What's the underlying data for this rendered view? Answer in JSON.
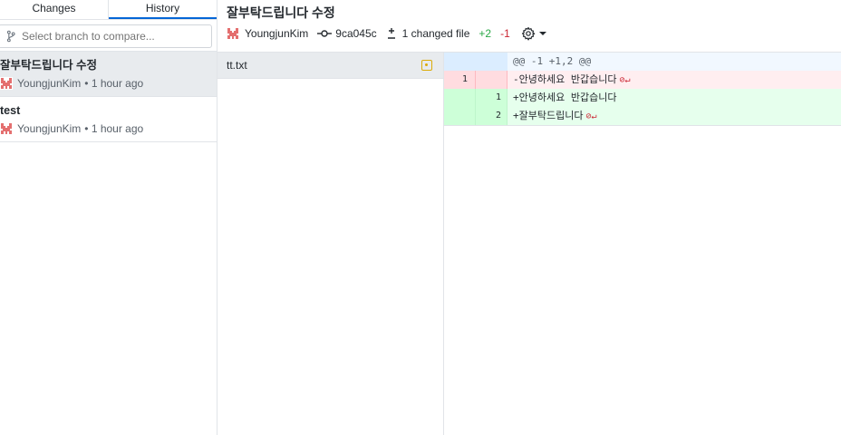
{
  "tabs": {
    "changes_label": "Changes",
    "history_label": "History"
  },
  "compare": {
    "placeholder": "Select branch to compare..."
  },
  "commits": [
    {
      "summary": "잘부탁드립니다 수정",
      "author": "YoungjunKim",
      "time": "• 1 hour ago",
      "selected": true
    },
    {
      "summary": "test",
      "author": "YoungjunKim",
      "time": "• 1 hour ago",
      "selected": false
    }
  ],
  "header": {
    "title": "잘부탁드립니다 수정",
    "author": "YoungjunKim",
    "sha": "9ca045c",
    "changed_files": "1 changed file",
    "additions": "+2",
    "deletions": "-1"
  },
  "files": [
    {
      "name": "tt.txt",
      "status": "modified"
    }
  ],
  "diff": {
    "hunk": "@@ -1 +1,2 @@",
    "lines": [
      {
        "type": "del",
        "old": "1",
        "new": "",
        "text": "-안녕하세요 반갑습니다"
      },
      {
        "type": "ins",
        "old": "",
        "new": "1",
        "text": "+안녕하세요 반갑습니다"
      },
      {
        "type": "ins",
        "old": "",
        "new": "2",
        "text": "+잘부탁드립니다"
      }
    ],
    "no_newline_marker": "⊘↵"
  },
  "icons": {
    "branch": "branch-icon",
    "avatar": "avatar-icon",
    "commit": "commit-icon",
    "diff": "diff-icon",
    "gear": "gear-icon",
    "modified": "file-modified-icon"
  },
  "colors": {
    "accent": "#0366d6",
    "added": "#28a745",
    "removed": "#cb2431",
    "modified": "#dbab09"
  }
}
